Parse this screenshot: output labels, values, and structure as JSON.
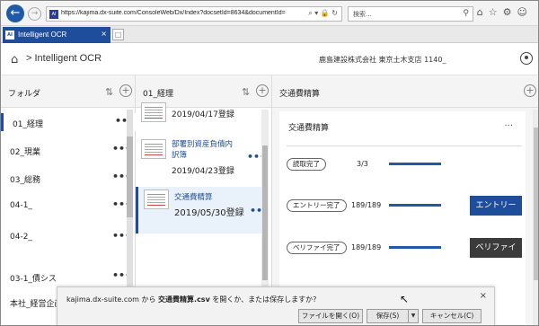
{
  "browser": {
    "url": "https://kajima.dx-suite.com/ConsoleWeb/Dx/Index?docsetId=8634&documentId=80553&",
    "site_icon": "AI",
    "url_tools": "⌕ ▾ 🔒 ↻",
    "search_placeholder": "検索...",
    "toolbar_icons": [
      "home-icon",
      "star-icon",
      "settings-gear-icon",
      "smiley-icon"
    ],
    "tab": {
      "icon": "AI",
      "title": "Intelligent OCR",
      "close": "×"
    }
  },
  "header": {
    "breadcrumb": "> Intelligent OCR",
    "company": "鹿島建設株式会社 東京土木支店 1140_"
  },
  "folders": {
    "title": "フォルダ",
    "items": [
      {
        "label": "01_経理",
        "more": "•••"
      },
      {
        "label": "02_現業",
        "more": "•••"
      },
      {
        "label": "03_総務",
        "more": "•••"
      },
      {
        "label": "04-1_",
        "more": "•••"
      },
      {
        "label": "04-2_",
        "more": "•••"
      },
      {
        "label": "03-1_債シス",
        "more": "•••"
      },
      {
        "label": "本社_経営企画",
        "more": ""
      }
    ]
  },
  "documents": {
    "title": "01_経理",
    "items": [
      {
        "name": "",
        "date": "2019/04/17登録",
        "more": ""
      },
      {
        "name": "部署別資産負債内訳簿",
        "date": "2019/04/23登録",
        "more": "•••"
      },
      {
        "name": "交通費精算",
        "date": "2019/05/30登録",
        "more": "•••"
      }
    ]
  },
  "detail": {
    "title": "交通費精算",
    "card_title": "交通費精算",
    "card_more": "...",
    "rows": [
      {
        "status": "読取完了",
        "count": "3/3",
        "progress": 1.0,
        "button": ""
      },
      {
        "status": "エントリー完了",
        "count": "189/189",
        "progress": 1.0,
        "button": "エントリー"
      },
      {
        "status": "ベリファイ完了",
        "count": "189/189",
        "progress": 1.0,
        "button": "ベリファイ"
      }
    ]
  },
  "download": {
    "site": "kajima.dx-suite.com",
    "mid": " から ",
    "file": "交通費精算.csv",
    "tail": " を開くか、または保存しますか?",
    "open_label": "ファイルを開く(O)",
    "save_label": "保存(S)",
    "cancel_label": "キャンセル(C)",
    "close": "×"
  },
  "colors": {
    "accent": "#1e4e9b",
    "dark_button": "#3b3b3b"
  }
}
